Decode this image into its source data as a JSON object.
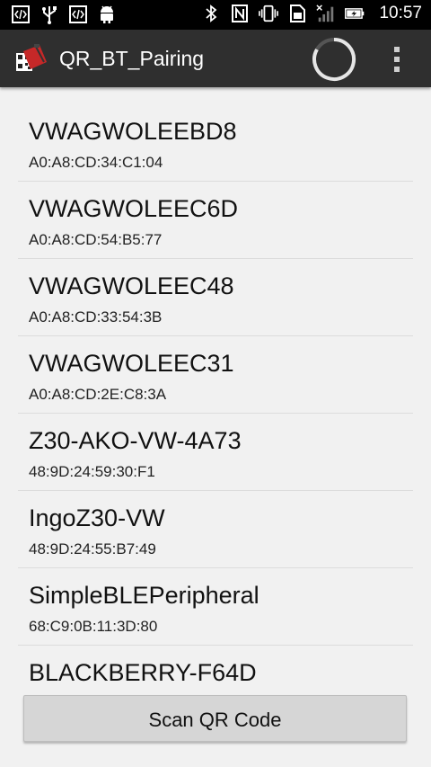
{
  "status_bar": {
    "time": "10:57",
    "icons_left": [
      "code-icon",
      "usb-icon",
      "code-icon",
      "android-icon"
    ],
    "icons_right": [
      "bluetooth-icon",
      "nfc-icon",
      "vibrate-icon",
      "sim-icon",
      "signal-icon",
      "battery-charging-icon"
    ]
  },
  "action_bar": {
    "title": "QR_BT_Pairing",
    "background": "#2f2f2f"
  },
  "devices": [
    {
      "name": "VWAGWOLEEBD8",
      "mac": "A0:A8:CD:34:C1:04"
    },
    {
      "name": "VWAGWOLEEC6D",
      "mac": "A0:A8:CD:54:B5:77"
    },
    {
      "name": "VWAGWOLEEC48",
      "mac": "A0:A8:CD:33:54:3B"
    },
    {
      "name": "VWAGWOLEEC31",
      "mac": "A0:A8:CD:2E:C8:3A"
    },
    {
      "name": "Z30-AKO-VW-4A73",
      "mac": "48:9D:24:59:30:F1"
    },
    {
      "name": "IngoZ30-VW",
      "mac": "48:9D:24:55:B7:49"
    },
    {
      "name": "SimpleBLEPeripheral",
      "mac": "68:C9:0B:11:3D:80"
    },
    {
      "name": "BLACKBERRY-F64D",
      "mac": ""
    }
  ],
  "footer": {
    "scan_button_label": "Scan QR Code"
  }
}
